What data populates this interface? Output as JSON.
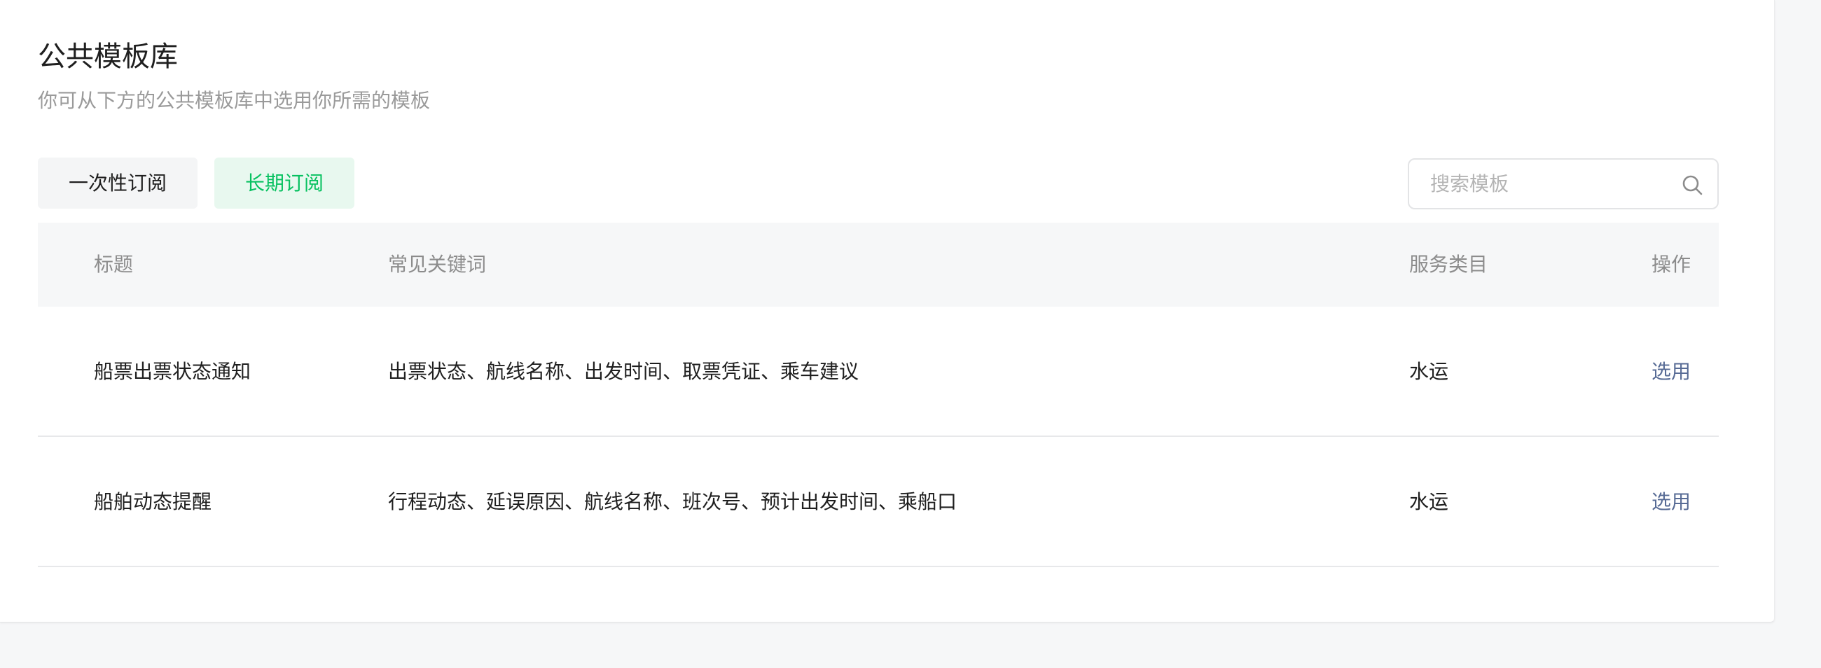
{
  "page": {
    "title": "公共模板库",
    "description": "你可从下方的公共模板库中选用你所需的模板"
  },
  "tabs": [
    {
      "label": "一次性订阅",
      "active": false
    },
    {
      "label": "长期订阅",
      "active": true
    }
  ],
  "search": {
    "placeholder": "搜索模板",
    "value": ""
  },
  "table": {
    "headers": {
      "title": "标题",
      "keywords": "常见关键词",
      "category": "服务类目",
      "action": "操作"
    },
    "rows": [
      {
        "title": "船票出票状态通知",
        "keywords": "出票状态、航线名称、出发时间、取票凭证、乘车建议",
        "category": "水运",
        "action": "选用"
      },
      {
        "title": "船舶动态提醒",
        "keywords": "行程动态、延误原因、航线名称、班次号、预计出发时间、乘船口",
        "category": "水运",
        "action": "选用"
      }
    ]
  },
  "colors": {
    "accent_green": "#07c160",
    "link_blue": "#576b95"
  },
  "icons": {
    "search": "search-icon"
  }
}
